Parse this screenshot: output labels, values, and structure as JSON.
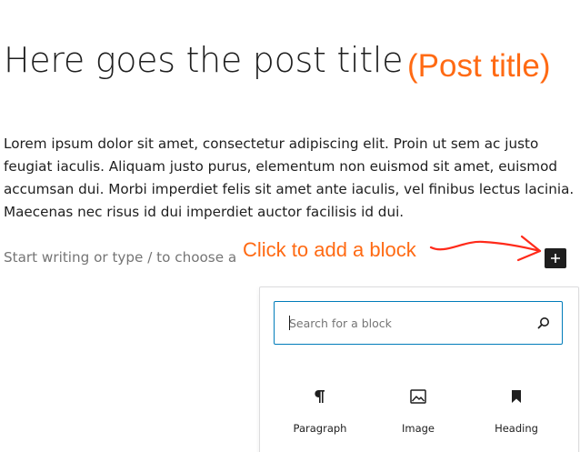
{
  "post": {
    "title": "Here goes the post title",
    "paragraph": "Lorem ipsum dolor sit amet, consectetur adipiscing elit. Proin ut sem ac justo feugiat iaculis. Aliquam justo purus, elementum non euismod sit amet, euismod accumsan dui. Morbi imperdiet felis sit amet ante iaculis, vel finibus lectus lacinia. Maecenas nec risus id dui imperdiet auctor facilisis id dui.",
    "placeholder": "Start writing or type / to choose a block"
  },
  "annotations": {
    "title_note": "(Post title)",
    "click_note": "Click to add a block",
    "color": "#ff6a13"
  },
  "add_block_button": {
    "icon": "plus-icon"
  },
  "inserter": {
    "search_placeholder": "Search for a block",
    "search_value": "",
    "accent_color": "#007cba",
    "blocks": [
      {
        "label": "Paragraph",
        "icon": "paragraph-icon"
      },
      {
        "label": "Image",
        "icon": "image-icon"
      },
      {
        "label": "Heading",
        "icon": "bookmark-icon"
      }
    ]
  }
}
